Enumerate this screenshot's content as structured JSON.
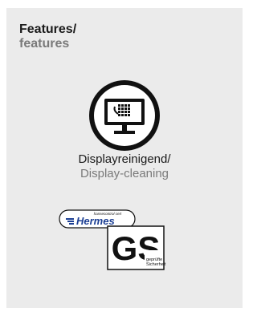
{
  "heading": {
    "de": "Features/",
    "en": "features"
  },
  "feature": {
    "icon": "monitor-screen-cleaning-icon",
    "label_de": "Displayreinigend/",
    "label_en": "Display-cleaning"
  },
  "certifications": {
    "hermes_top": "hansecontrol cert",
    "hermes_name": "Hermes",
    "gs_mark": "GS",
    "gs_text_line1": "geprüfte",
    "gs_text_line2": "Sicherheit"
  },
  "colors": {
    "panel": "#ebebeb",
    "text_dark": "#1a1a1a",
    "text_grey": "#7a7a7a",
    "hermes_blue": "#1c3f94"
  }
}
